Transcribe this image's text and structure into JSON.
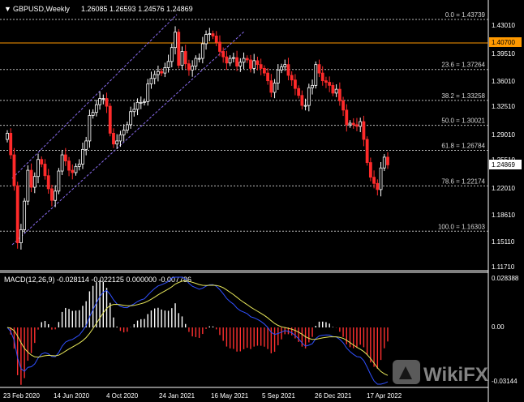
{
  "header": {
    "symbol": "GBPUSD,Weekly",
    "ohlc": "1.26085 1.26593 1.24576 1.24869"
  },
  "price_axis": {
    "ticks": [
      "1.43010",
      "1.39510",
      "1.36010",
      "1.32510",
      "1.29010",
      "1.25510",
      "1.22010",
      "1.18610",
      "1.15110",
      "1.11710"
    ],
    "level_label": "1.40700",
    "current_label": "1.24869"
  },
  "fib_levels": [
    {
      "label": "0.0 = 1.43739",
      "value": 1.43739
    },
    {
      "label": "23.6 = 1.37264",
      "value": 1.37264
    },
    {
      "label": "38.2 = 1.33258",
      "value": 1.33258
    },
    {
      "label": "50.0 = 1.30021",
      "value": 1.30021
    },
    {
      "label": "61.8 = 1.26784",
      "value": 1.26784
    },
    {
      "label": "78.6 = 1.22174",
      "value": 1.22174
    },
    {
      "label": "100.0 = 1.16303",
      "value": 1.16303
    }
  ],
  "macd": {
    "label": "MACD(12,26,9) -0.028114 -0.022125 0.000000 -0.007786",
    "ticks": [
      "0.028388",
      "0.00",
      "-0.03144"
    ]
  },
  "time_axis": [
    "23 Feb 2020",
    "14 Jun 2020",
    "4 Oct 2020",
    "24 Jan 2021",
    "16 May 2021",
    "5 Sep 2021",
    "26 Dec 2021",
    "17 Apr 2022"
  ],
  "watermark": "WikiFX",
  "colors": {
    "bull": "#ffffff",
    "bear": "#ff2a2a",
    "level": "#ff9900",
    "channel": "#8a6cf0",
    "macd_line": "#3050ff",
    "signal_line": "#e8e85a",
    "hist_pos": "#ffffff",
    "hist_neg": "#ff3030"
  },
  "chart_data": {
    "type": "candlestick",
    "y_range": [
      1.11,
      1.45
    ],
    "closes": [
      1.29,
      1.262,
      1.222,
      1.148,
      1.165,
      1.202,
      1.242,
      1.22,
      1.234,
      1.256,
      1.25,
      1.235,
      1.218,
      1.203,
      1.215,
      1.241,
      1.262,
      1.254,
      1.242,
      1.239,
      1.247,
      1.25,
      1.269,
      1.28,
      1.313,
      1.317,
      1.327,
      1.335,
      1.335,
      1.325,
      1.29,
      1.276,
      1.28,
      1.288,
      1.294,
      1.301,
      1.318,
      1.321,
      1.33,
      1.33,
      1.331,
      1.354,
      1.361,
      1.366,
      1.37,
      1.368,
      1.375,
      1.383,
      1.401,
      1.421,
      1.378,
      1.396,
      1.38,
      1.372,
      1.377,
      1.387,
      1.387,
      1.406,
      1.418,
      1.419,
      1.416,
      1.408,
      1.396,
      1.389,
      1.381,
      1.387,
      1.388,
      1.377,
      1.382,
      1.387,
      1.385,
      1.374,
      1.384,
      1.379,
      1.374,
      1.368,
      1.358,
      1.343,
      1.355,
      1.372,
      1.376,
      1.379,
      1.365,
      1.359,
      1.348,
      1.339,
      1.326,
      1.326,
      1.349,
      1.352,
      1.379,
      1.368,
      1.358,
      1.356,
      1.352,
      1.342,
      1.347,
      1.332,
      1.32,
      1.301,
      1.303,
      1.301,
      1.299,
      1.305,
      1.282,
      1.252,
      1.233,
      1.225,
      1.217,
      1.245,
      1.259,
      1.249
    ]
  }
}
